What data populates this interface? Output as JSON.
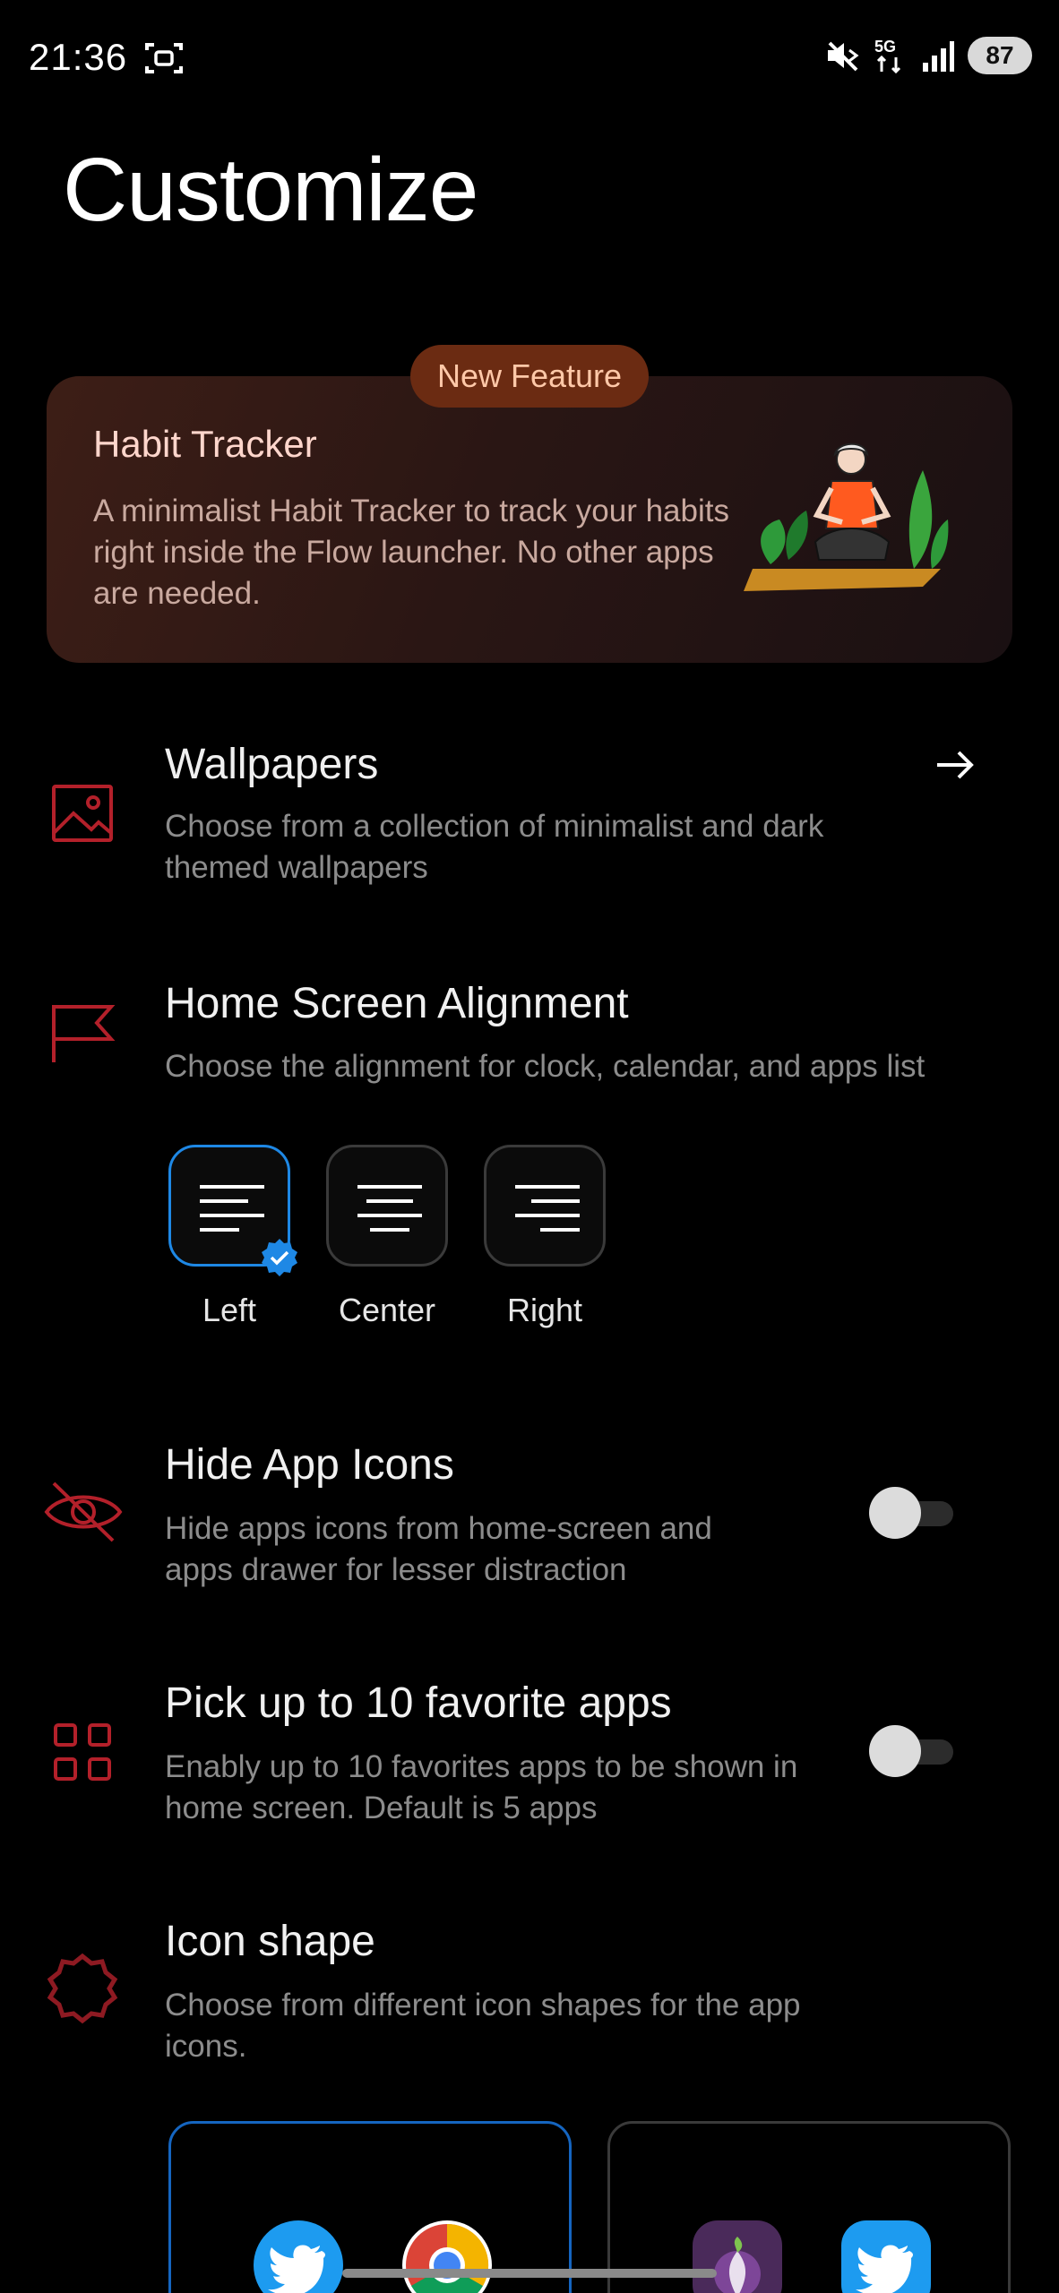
{
  "status_bar": {
    "time": "21:36",
    "battery": "87",
    "network": "5G"
  },
  "page": {
    "title": "Customize"
  },
  "feature_card": {
    "badge": "New Feature",
    "title": "Habit Tracker",
    "description": "A minimalist Habit Tracker to track your habits right inside the Flow launcher. No other apps are needed."
  },
  "settings": {
    "wallpapers": {
      "title": "Wallpapers",
      "description": "Choose from a collection of minimalist and dark themed wallpapers"
    },
    "alignment": {
      "title": "Home Screen Alignment",
      "description": "Choose the alignment for clock, calendar, and apps list",
      "options": [
        {
          "label": "Left",
          "selected": true
        },
        {
          "label": "Center",
          "selected": false
        },
        {
          "label": "Right",
          "selected": false
        }
      ]
    },
    "hide_icons": {
      "title": "Hide App Icons",
      "description": "Hide apps icons from home-screen and apps drawer for lesser distraction",
      "enabled": false
    },
    "favorites": {
      "title": "Pick up to 10 favorite apps",
      "description": "Enably up to 10 favorites apps to be shown in home screen. Default is 5 apps",
      "enabled": false
    },
    "icon_shape": {
      "title": "Icon shape",
      "description": "Choose from different icon shapes for the app icons."
    }
  },
  "colors": {
    "accent": "#b3202a",
    "selection": "#1e88e5",
    "badge_bg": "#6b2b12"
  }
}
